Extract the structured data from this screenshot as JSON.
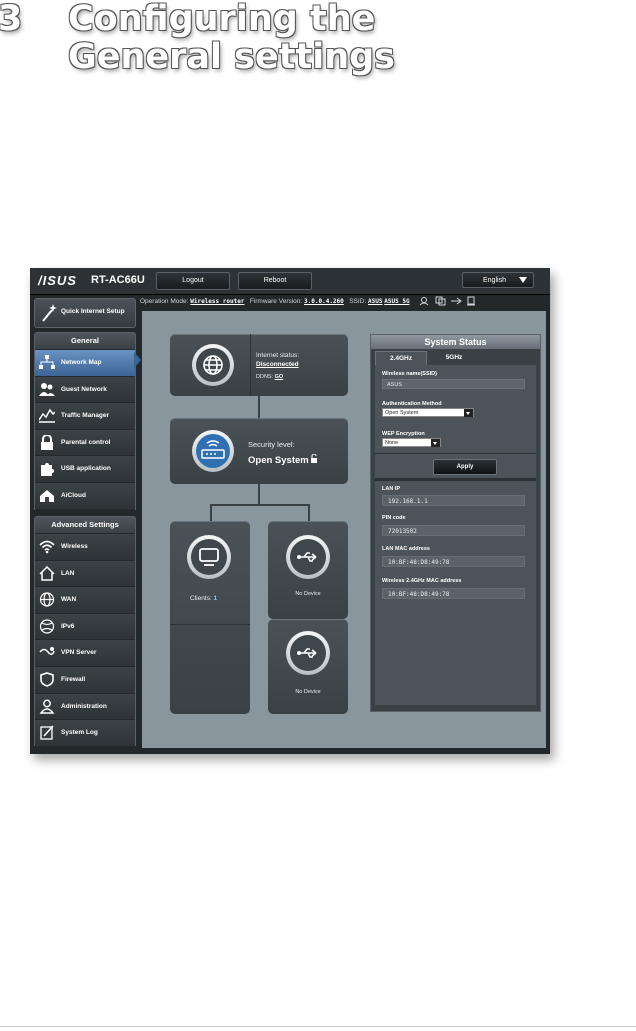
{
  "heading": {
    "number": "3",
    "title": "Configuring the General settings"
  },
  "router": {
    "logo": "/ISUS",
    "model": "RT-AC66U",
    "buttons": {
      "logout": "Logout",
      "reboot": "Reboot",
      "language": "English"
    },
    "info": {
      "op_mode_label": "Operation Mode:",
      "op_mode_value": "Wireless router",
      "fw_label": "Firmware Version:",
      "fw_value": "3.0.0.4.260",
      "ssid_label": "SSID:",
      "ssid_1": "ASUS",
      "ssid_2": "ASUS_5G"
    },
    "sidebar": {
      "quick_setup": "Quick Internet Setup",
      "general_header": "General",
      "general_items": [
        {
          "label": "Network Map",
          "icon": "network-map-icon"
        },
        {
          "label": "Guest Network",
          "icon": "guest-network-icon"
        },
        {
          "label": "Traffic Manager",
          "icon": "traffic-manager-icon"
        },
        {
          "label": "Parental control",
          "icon": "lock-icon"
        },
        {
          "label": "USB application",
          "icon": "puzzle-icon"
        },
        {
          "label": "AiCloud",
          "icon": "cloud-home-icon"
        }
      ],
      "advanced_header": "Advanced Settings",
      "advanced_items": [
        {
          "label": "Wireless",
          "icon": "wireless-icon"
        },
        {
          "label": "LAN",
          "icon": "home-icon"
        },
        {
          "label": "WAN",
          "icon": "globe-icon"
        },
        {
          "label": "IPv6",
          "icon": "ipv6-globe-icon"
        },
        {
          "label": "VPN Server",
          "icon": "vpn-icon"
        },
        {
          "label": "Firewall",
          "icon": "shield-icon"
        },
        {
          "label": "Administration",
          "icon": "admin-user-icon"
        },
        {
          "label": "System Log",
          "icon": "log-icon"
        }
      ]
    },
    "map": {
      "internet_status_label": "Internet status:",
      "internet_status_value": "Disconnected",
      "ddns_label": "DDNS:",
      "ddns_value": "GO",
      "security_label": "Security level:",
      "security_value": "Open System",
      "clients_label": "Clients:",
      "clients_count": "1",
      "usb1": "No Device",
      "usb2": "No Device"
    },
    "system_status": {
      "title": "System Status",
      "tab_24": "2.4GHz",
      "tab_5": "5GHz",
      "ssid_label": "Wireless name(SSID)",
      "ssid_value": "ASUS",
      "auth_label": "Authentication Method",
      "auth_value": "Open System",
      "wep_label": "WEP Encryption",
      "wep_value": "None",
      "apply": "Apply",
      "lan_ip_label": "LAN IP",
      "lan_ip_value": "192.168.1.1",
      "pin_label": "PIN code",
      "pin_value": "72013502",
      "lan_mac_label": "LAN MAC address",
      "lan_mac_value": "10:BF:48:D8:49:78",
      "wl_mac_label": "Wireless 2.4GHz MAC address",
      "wl_mac_value": "10:BF:48:D8:49:78"
    }
  }
}
